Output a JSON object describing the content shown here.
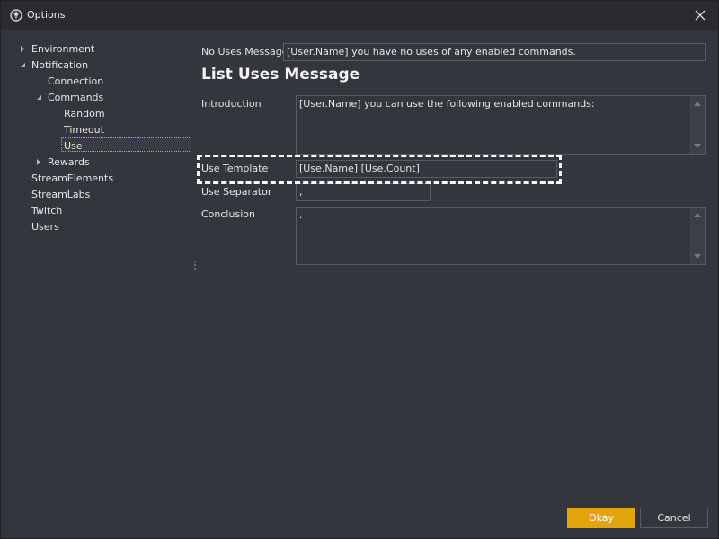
{
  "window": {
    "title": "Options"
  },
  "tree": {
    "items": [
      {
        "label": "Environment",
        "arrow": "collapsed"
      },
      {
        "label": "Notification",
        "arrow": "expanded"
      },
      {
        "label": "Connection",
        "arrow": "none"
      },
      {
        "label": "Commands",
        "arrow": "expanded"
      },
      {
        "label": "Random",
        "arrow": "none"
      },
      {
        "label": "Timeout",
        "arrow": "none"
      },
      {
        "label": "Use",
        "arrow": "none",
        "selected": true
      },
      {
        "label": "Rewards",
        "arrow": "collapsed"
      },
      {
        "label": "StreamElements",
        "arrow": "none"
      },
      {
        "label": "StreamLabs",
        "arrow": "none"
      },
      {
        "label": "Twitch",
        "arrow": "none"
      },
      {
        "label": "Users",
        "arrow": "none"
      }
    ]
  },
  "form": {
    "no_uses_label": "No Uses Message",
    "no_uses_value": "[User.Name] you have no uses of any enabled commands.",
    "section_heading": "List Uses Message",
    "intro_label": "Introduction",
    "intro_value": "[User.Name] you can use the following enabled commands:",
    "template_label": "Use Template",
    "template_value": "[Use.Name] [Use.Count]",
    "separator_label": "Use Separator",
    "separator_value": ",",
    "conclusion_label": "Conclusion",
    "conclusion_value": "."
  },
  "buttons": {
    "okay": "Okay",
    "cancel": "Cancel"
  },
  "colors": {
    "accent": "#e3a50d",
    "background": "#34363d",
    "titlebar": "#2a2b30"
  },
  "icons": {
    "app": "gear-shield-icon",
    "close": "close-icon",
    "tree_collapsed": "triangle-right-icon",
    "tree_expanded": "triangle-down-right-icon"
  }
}
